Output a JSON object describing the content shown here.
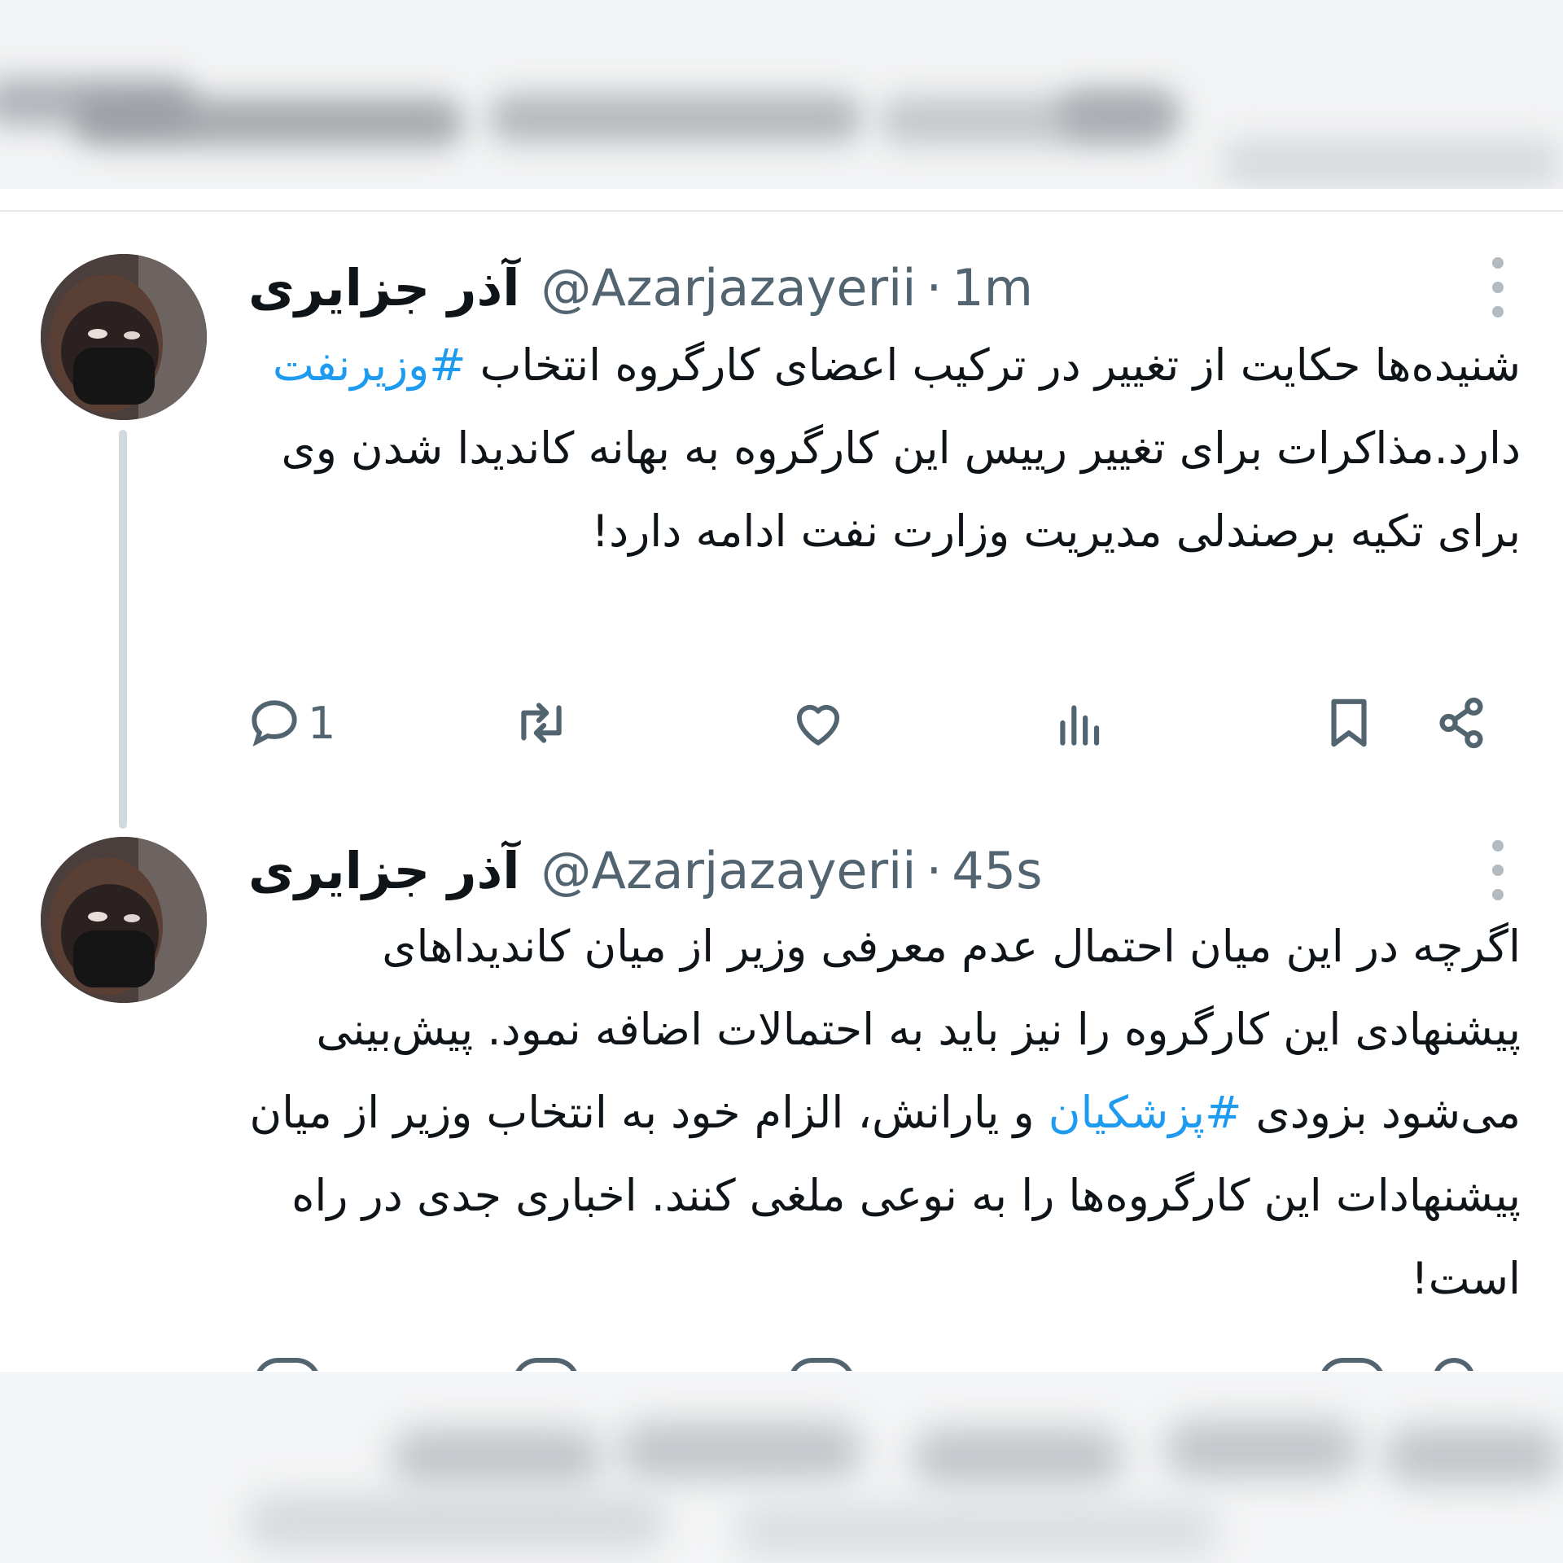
{
  "tweets": [
    {
      "display_name": "آذر جزایری",
      "handle": "@Azarjazayerii",
      "separator": "·",
      "time": "1m",
      "text_before": "شنیده‌ها حکایت از تغییر در ترکیب اعضای کارگروه انتخاب ",
      "hashtag": "#وزیرنفت",
      "text_after": " دارد.مذاکرات برای تغییر رییس این کارگروه به بهانه کاندیدا شدن وی برای تکیه برصندلی مدیریت وزارت نفت ادامه دارد!",
      "reply_count": "1"
    },
    {
      "display_name": "آذر جزایری",
      "handle": "@Azarjazayerii",
      "separator": "·",
      "time": "45s",
      "text_before": "اگرچه در این میان احتمال عدم معرفی وزیر از میان کاندیداهای پیشنهادی این کارگروه را نیز باید به احتمالات اضافه نمود. پیش‌بینی می‌شود بزودی ",
      "hashtag": "#پزشکیان",
      "text_after": " و یارانش، الزام خود به انتخاب وزیر از میان پیشنهادات این کارگروه‌ها را به نوعی ملغی کنند. اخباری جدی در راه است!"
    }
  ],
  "icons": [
    "reply-icon",
    "retweet-icon",
    "like-icon",
    "views-icon",
    "bookmark-icon",
    "share-icon",
    "more-icon"
  ],
  "colors": {
    "hashtag": "#1d9bf0",
    "meta": "#536471",
    "text": "#0f1419",
    "thread_line": "#cfd9de"
  }
}
